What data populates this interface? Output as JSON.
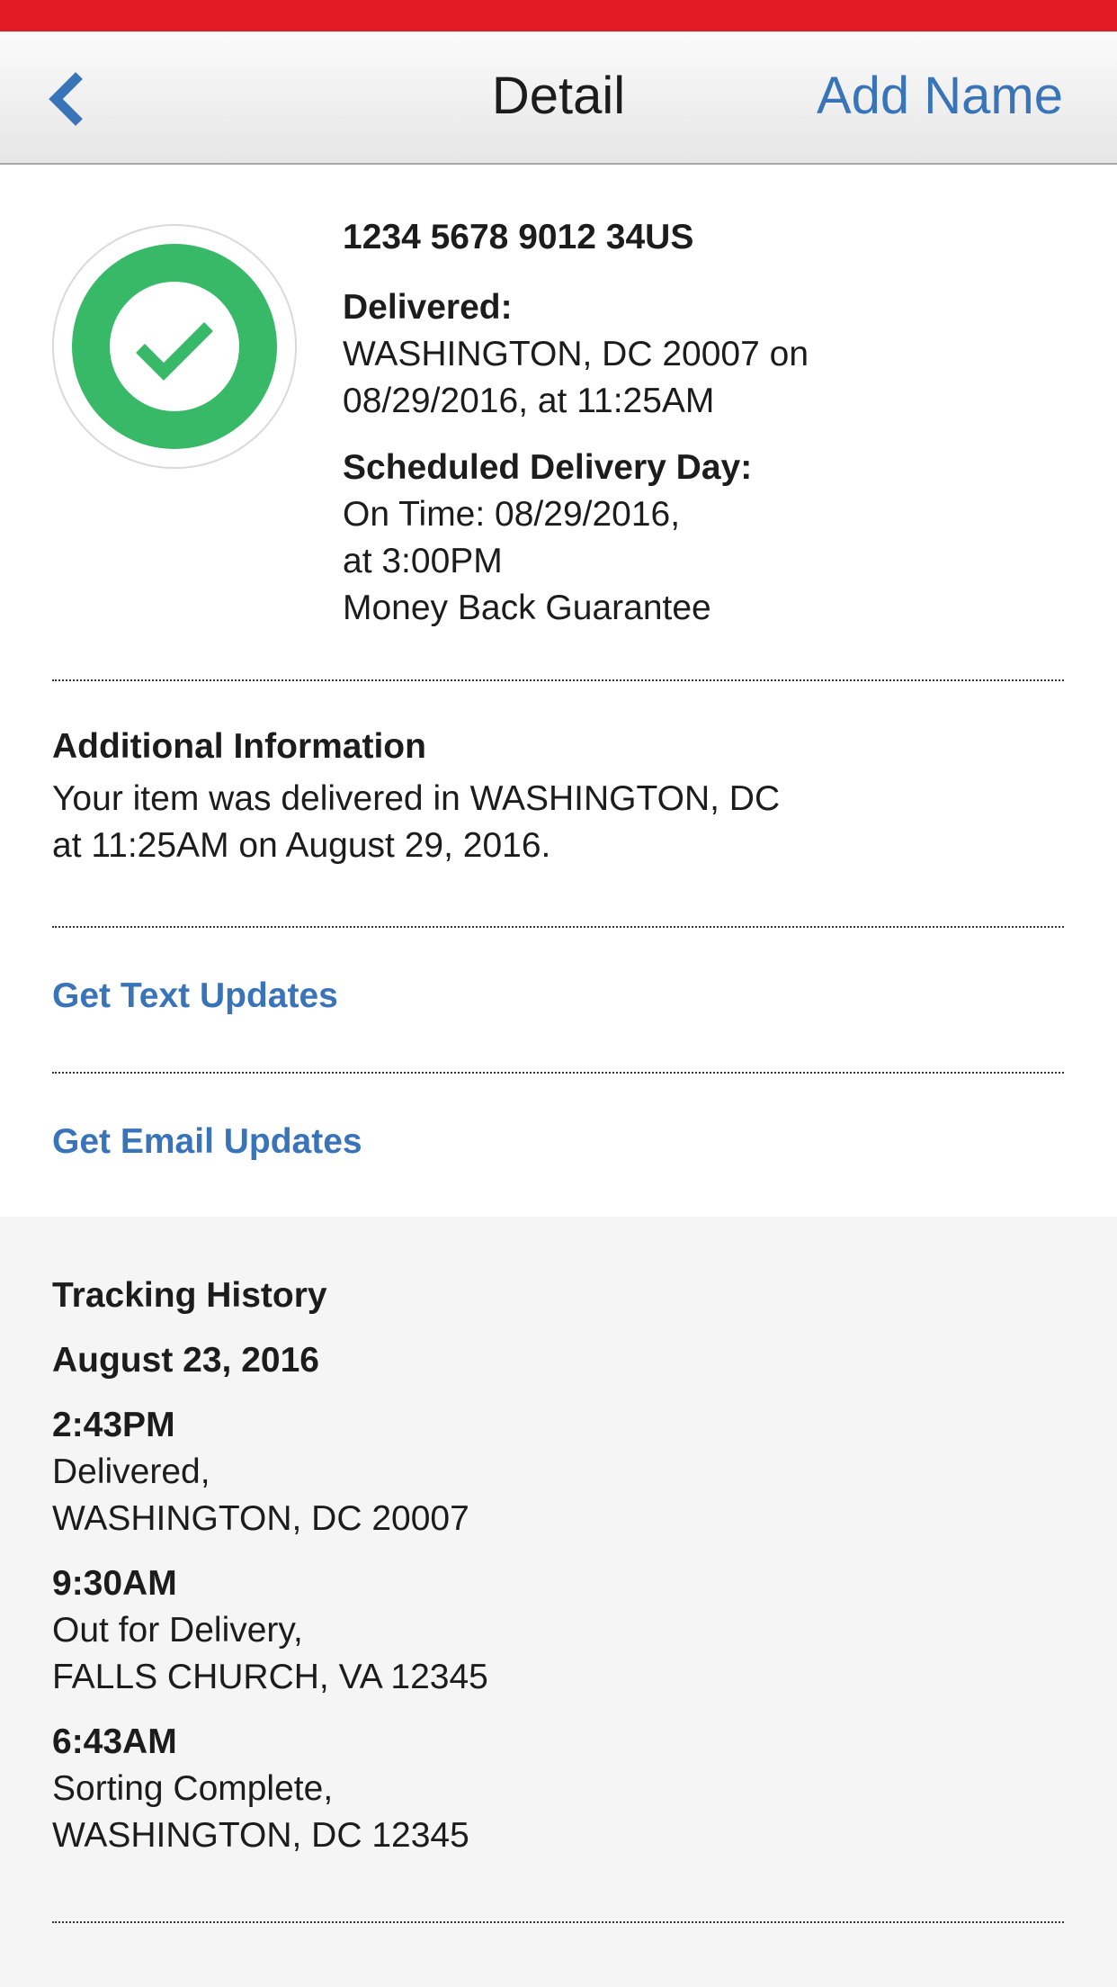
{
  "header": {
    "title": "Detail",
    "add_name_label": "Add Name",
    "status_bar_color": "#e21a23",
    "link_color": "#3a74b8"
  },
  "summary": {
    "status_icon": "check-circle-icon",
    "status_color": "#38b967",
    "tracking_number": "1234 5678 9012 34US",
    "delivered_label": "Delivered:",
    "delivered_line1": "WASHINGTON, DC 20007 on",
    "delivered_line2": "08/29/2016, at 11:25AM",
    "scheduled_label": "Scheduled Delivery Day:",
    "scheduled_line1": "On Time: 08/29/2016,",
    "scheduled_line2": "at 3:00PM",
    "scheduled_line3": "Money Back Guarantee"
  },
  "additional": {
    "title": "Additional Information",
    "line1": "Your item was delivered in WASHINGTON, DC",
    "line2": "at 11:25AM on August 29, 2016."
  },
  "links": {
    "text_updates": "Get Text Updates",
    "email_updates": "Get Email Updates"
  },
  "history": {
    "title": "Tracking History",
    "date": "August 23, 2016",
    "events": [
      {
        "time": "2:43PM",
        "status": "Delivered,",
        "location": "WASHINGTON, DC 20007"
      },
      {
        "time": "9:30AM",
        "status": "Out for Delivery,",
        "location": "FALLS CHURCH, VA 12345"
      },
      {
        "time": "6:43AM",
        "status": "Sorting Complete,",
        "location": "WASHINGTON, DC 12345"
      }
    ]
  }
}
